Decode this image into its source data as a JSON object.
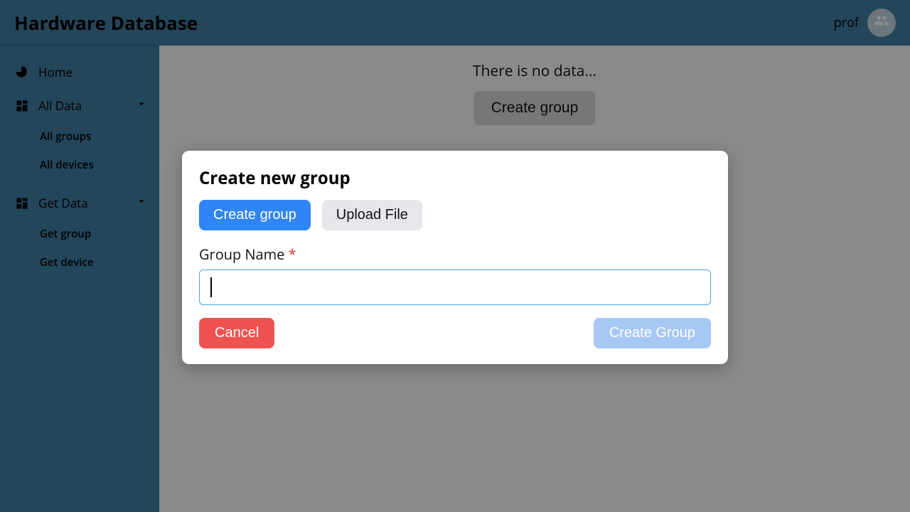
{
  "header": {
    "title": "Hardware Database",
    "user": "prof"
  },
  "sidebar": {
    "home": "Home",
    "all_data": {
      "label": "All Data",
      "children": [
        "All groups",
        "All devices"
      ]
    },
    "get_data": {
      "label": "Get Data",
      "children": [
        "Get group",
        "Get device"
      ]
    }
  },
  "main": {
    "no_data": "There is no data...",
    "create_group_btn": "Create group"
  },
  "modal": {
    "title": "Create new group",
    "tab_create": "Create group",
    "tab_upload": "Upload File",
    "group_name_label": "Group Name",
    "required_mark": "*",
    "group_name_value": "",
    "cancel": "Cancel",
    "submit": "Create Group"
  }
}
